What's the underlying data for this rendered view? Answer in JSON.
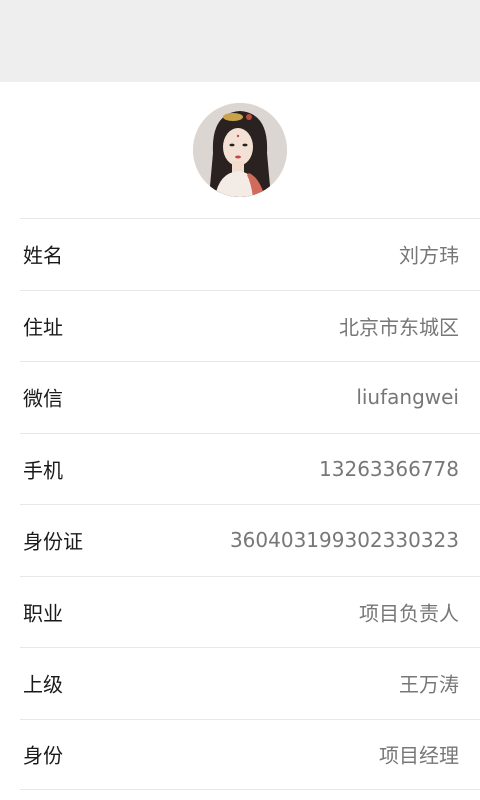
{
  "profile": {
    "fields": [
      {
        "label": "姓名",
        "value": "刘方玮"
      },
      {
        "label": "住址",
        "value": "北京市东城区"
      },
      {
        "label": "微信",
        "value": "liufangwei"
      },
      {
        "label": "手机",
        "value": "13263366778"
      },
      {
        "label": "身份证",
        "value": "360403199302330323"
      },
      {
        "label": "职业",
        "value": "项目负责人"
      },
      {
        "label": "上级",
        "value": "王万涛"
      },
      {
        "label": "身份",
        "value": "项目经理"
      }
    ]
  },
  "colors": {
    "header_bg": "#eeeeee",
    "label_text": "#1a1a1a",
    "value_text": "#777777",
    "divider": "#e8e8e8"
  }
}
